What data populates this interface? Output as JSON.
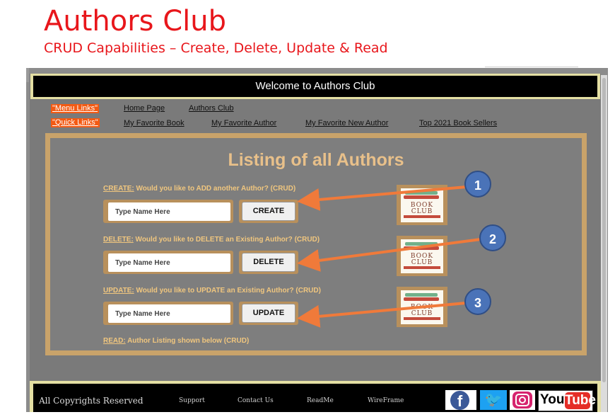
{
  "slide": {
    "title": "Authors Club",
    "subtitle": "CRUD Capabilities – Create, Delete, Update & Read"
  },
  "site": {
    "banner": "Welcome to Authors Club",
    "menu_links_tag": "\"Menu Links\"",
    "quick_links_tag": "\"Quick Links\"",
    "menu_links": [
      "Home Page",
      "Authors Club"
    ],
    "quick_links": [
      "My Favorite Book",
      "My Favorite Author",
      "My Favorite New Author",
      "Top 2021 Book Sellers"
    ]
  },
  "panel": {
    "title": "Listing of all Authors",
    "create": {
      "label": "CREATE:",
      "question": " Would you like to ADD another Author? (CRUD)",
      "placeholder": "Type Name Here",
      "button": "CREATE"
    },
    "delete": {
      "label": "DELETE:",
      "question": " Would you like to DELETE an Existing Author? (CRUD)",
      "placeholder": "Type Name Here",
      "button": "DELETE"
    },
    "update": {
      "label": "UPDATE:",
      "question": " Would you like to UPDATE an Existing Author? (CRUD)",
      "placeholder": "Type Name Here",
      "button": "UPDATE"
    },
    "read": {
      "label": "READ:",
      "text": " Author Listing shown below (CRUD)"
    },
    "book_image_text": "BOOK\nCLUB"
  },
  "footer": {
    "copyright": "All Copyrights Reserved",
    "links": [
      "Support",
      "Contact Us",
      "ReadMe",
      "WireFrame"
    ],
    "social": [
      "facebook-icon",
      "twitter-icon",
      "instagram-icon",
      "youtube-icon"
    ],
    "youtube_you": "You",
    "youtube_tube": "Tube"
  },
  "callouts": [
    "1",
    "2",
    "3"
  ],
  "colors": {
    "slide_title": "#e8161b",
    "accent_gold": "#f0c67e",
    "arrow": "#f07a3a",
    "callout": "#4a73b8"
  }
}
